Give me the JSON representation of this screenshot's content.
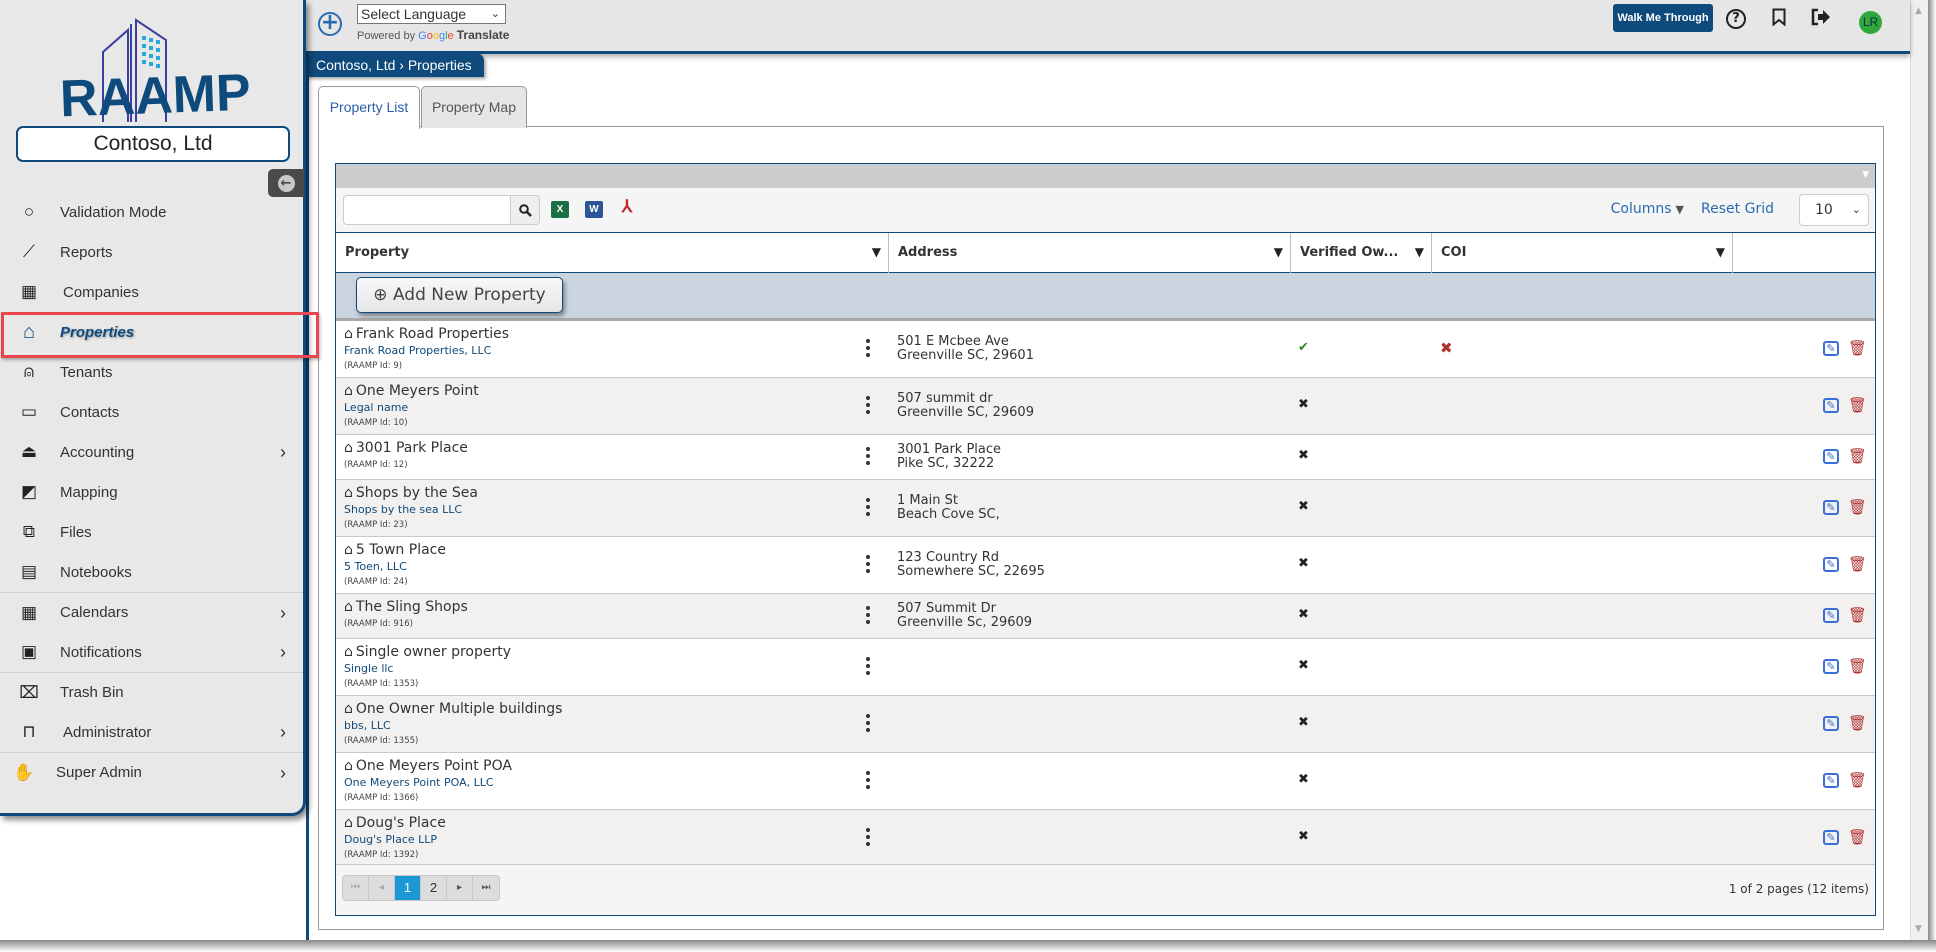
{
  "app": {
    "logo_text": "RAAMP",
    "company_name": "Contoso, Ltd"
  },
  "colors": {
    "brand": "#0e4a7b",
    "link": "#2a6ab0",
    "highlight": "#e8474e",
    "verified_yes": "#2a8a2a",
    "coi_no": "#b03030",
    "pager_current": "#1b98d5"
  },
  "sidebar": {
    "collapse_icon": "arrow-left-circle",
    "items": [
      {
        "label": "Validation Mode",
        "icon": "○",
        "has_children": false
      },
      {
        "label": "Reports",
        "icon": "📈",
        "has_children": false
      },
      {
        "label": "Companies",
        "icon": "▦",
        "has_children": false
      },
      {
        "label": "Properties",
        "icon": "⌂",
        "has_children": false,
        "active": true
      },
      {
        "label": "Tenants",
        "icon": "👤",
        "has_children": false
      },
      {
        "label": "Contacts",
        "icon": "🪪",
        "has_children": false
      },
      {
        "label": "Accounting",
        "icon": "⏏",
        "has_children": true
      },
      {
        "label": "Mapping",
        "icon": "🗺",
        "has_children": false
      },
      {
        "label": "Files",
        "icon": "⧉",
        "has_children": false
      },
      {
        "label": "Notebooks",
        "icon": "▤",
        "has_children": false
      },
      {
        "label": "Calendars",
        "icon": "▦",
        "has_children": true
      },
      {
        "label": "Notifications",
        "icon": "▣",
        "has_children": true
      },
      {
        "label": "Trash Bin",
        "icon": "🗑",
        "has_children": false
      },
      {
        "label": "Administrator",
        "icon": "🔒",
        "has_children": true
      },
      {
        "label": "Super Admin",
        "icon": "✋",
        "has_children": true
      }
    ],
    "chevron": "›"
  },
  "header": {
    "add_icon": "+",
    "language_select": "Select Language",
    "powered_by": "Powered by",
    "google": [
      "G",
      "o",
      "o",
      "g",
      "l",
      "e"
    ],
    "translate": "Translate",
    "walk_me_through": "Walk Me Through",
    "help_icon": "?",
    "bookmark_icon": "🔖",
    "logout_icon": "➜",
    "avatar_initials": "LR"
  },
  "breadcrumb": "Contoso, Ltd › Properties",
  "tabs": [
    {
      "label": "Property List",
      "active": true
    },
    {
      "label": "Property Map",
      "active": false
    }
  ],
  "grid": {
    "search_value": "",
    "search_icon": "🔍",
    "export_excel": "X",
    "export_word": "W",
    "export_pdf": "⅄",
    "columns_label": "Columns",
    "reset_label": "Reset Grid",
    "page_size": "10",
    "columns": [
      "Property",
      "Address",
      "Verified Ow...",
      "COI",
      ""
    ],
    "filter_icon": "▼",
    "add_button": "⊕ Add New Property",
    "rows": [
      {
        "name": "Frank Road Properties",
        "legal": "Frank Road Properties, LLC",
        "id": "(RAAMP Id: 9)",
        "addr1": "501 E Mcbee Ave",
        "addr2": "Greenville SC, 29601",
        "verified": "✔",
        "verified_ok": true,
        "coi": "✖"
      },
      {
        "name": "One Meyers Point",
        "legal": "Legal name",
        "id": "(RAAMP Id: 10)",
        "addr1": "507 summit dr",
        "addr2": "Greenville  SC, 29609",
        "verified": "✖",
        "verified_ok": false,
        "coi": ""
      },
      {
        "name": "3001 Park Place",
        "legal": "",
        "id": "(RAAMP Id: 12)",
        "addr1": "3001 Park Place",
        "addr2": "Pike  SC, 32222",
        "verified": "✖",
        "verified_ok": false,
        "coi": ""
      },
      {
        "name": "Shops by the Sea",
        "legal": "Shops by the sea LLC",
        "id": "(RAAMP Id: 23)",
        "addr1": "1 Main St",
        "addr2": "Beach Cove SC,",
        "verified": "✖",
        "verified_ok": false,
        "coi": ""
      },
      {
        "name": "5 Town Place",
        "legal": "5 Toen, LLC",
        "id": "(RAAMP Id: 24)",
        "addr1": "123 Country Rd",
        "addr2": "Somewhere SC, 22695",
        "verified": "✖",
        "verified_ok": false,
        "coi": ""
      },
      {
        "name": "The Sling Shops",
        "legal": "",
        "id": "(RAAMP Id: 916)",
        "addr1": "507 Summit Dr",
        "addr2": "Greenville Sc, 29609",
        "verified": "✖",
        "verified_ok": false,
        "coi": ""
      },
      {
        "name": "Single owner property",
        "legal": "Single llc",
        "id": "(RAAMP Id: 1353)",
        "addr1": "",
        "addr2": "",
        "verified": "✖",
        "verified_ok": false,
        "coi": ""
      },
      {
        "name": "One Owner Multiple buildings",
        "legal": "bbs, LLC",
        "id": "(RAAMP Id: 1355)",
        "addr1": "",
        "addr2": "",
        "verified": "✖",
        "verified_ok": false,
        "coi": ""
      },
      {
        "name": "One Meyers Point POA",
        "legal": "One Meyers Point POA, LLC",
        "id": "(RAAMP Id: 1366)",
        "addr1": "",
        "addr2": "",
        "verified": "✖",
        "verified_ok": false,
        "coi": ""
      },
      {
        "name": "Doug's Place",
        "legal": "Doug's Place LLP",
        "id": "(RAAMP Id: 1392)",
        "addr1": "",
        "addr2": "",
        "verified": "✖",
        "verified_ok": false,
        "coi": ""
      }
    ],
    "pager": {
      "first": "⏮",
      "prev": "◂",
      "pages": [
        "1",
        "2"
      ],
      "current": "1",
      "next": "▸",
      "last": "⏭",
      "info": "1 of 2 pages (12 items)"
    }
  }
}
